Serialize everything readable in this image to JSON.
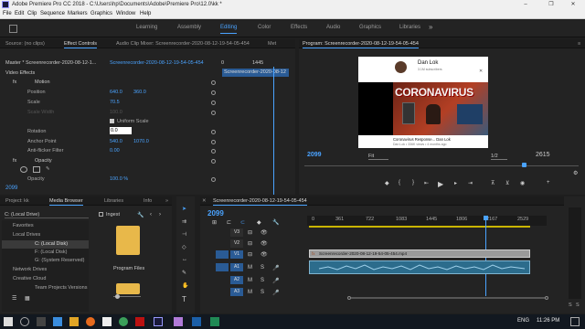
{
  "window": {
    "title": "Adobe Premiere Pro CC 2018 - C:\\Users\\hp\\Documents\\Adobe\\Premiere Pro\\12.0\\kk *",
    "minimize": "–",
    "maximize": "❐",
    "close": "✕"
  },
  "menu": [
    "File",
    "Edit",
    "Clip",
    "Sequence",
    "Markers",
    "Graphics",
    "Window",
    "Help"
  ],
  "workspaces": {
    "items": [
      "Learning",
      "Assembly",
      "Editing",
      "Color",
      "Effects",
      "Audio",
      "Graphics",
      "Libraries"
    ],
    "active": "Editing",
    "more": "»"
  },
  "effect_controls": {
    "tabs": [
      "Source: (no clips)",
      "Effect Controls",
      "Audio Clip Mixer: Screenrecorder-2020-08-12-19-54-05-454",
      "Met"
    ],
    "clip_path": "Master * Screenrecorder-2020-08-12-1...",
    "clip_name": "Screenrecorder-2020-08-12-19-54-05-454",
    "section_video": "Video Effects",
    "timecodes": [
      "0",
      "1445"
    ],
    "clip_label": "Screenrecorder-2020-08-12",
    "motion": "Motion",
    "position": {
      "label": "Position",
      "x": "640.0",
      "y": "360.0"
    },
    "scale": {
      "label": "Scale",
      "value": "70.5"
    },
    "scale_width": {
      "label": "Scale Width",
      "value": "100.0"
    },
    "uniform_scale": "Uniform Scale",
    "rotation": {
      "label": "Rotation",
      "value": "0.0"
    },
    "anchor": {
      "label": "Anchor Point",
      "x": "540.0",
      "y": "1070.0"
    },
    "anti_flicker": {
      "label": "Anti-flicker Filter",
      "value": "0.00"
    },
    "opacity": "Opacity",
    "opacity_value": {
      "label": "Opacity",
      "value": "100.0 %"
    },
    "timecode": "2099"
  },
  "program": {
    "title": "Program: Screenrecorder-2020-08-12-19-54-05-454",
    "menu": "≡",
    "video": {
      "channel": "Dan Lok",
      "subs": "3.1M subscribers",
      "headline": "CORONAVIRUS",
      "caption1": "Coronavirus Response... Dan Lok",
      "caption2": "Dan Lok • 336K views • 4 months ago"
    },
    "timecode": "2099",
    "fit": "Fit",
    "resolution": "1/2",
    "duration": "2615",
    "progress": 0.8
  },
  "project": {
    "tabs": [
      "Project: kk",
      "Media Browser",
      "Libraries",
      "Info"
    ],
    "more": "»",
    "drive_select": "C: (Local Drive)",
    "ingest": "Ingest",
    "tree": [
      {
        "label": "Favorites",
        "level": 0
      },
      {
        "label": "Local Drives",
        "level": 0
      },
      {
        "label": "C: (Local Disk)",
        "level": 1
      },
      {
        "label": "F: (Local Disk)",
        "level": 1
      },
      {
        "label": "G: (System Reserved)",
        "level": 1
      },
      {
        "label": "Network Drives",
        "level": 0
      },
      {
        "label": "Creative Cloud",
        "level": 0
      },
      {
        "label": "Team Projects Versions",
        "level": 1
      }
    ],
    "folder_label": "Program Files"
  },
  "timeline": {
    "title": "Screenrecorder-2020-08-12-19-54-05-454",
    "timecode": "2099",
    "ruler": [
      "0",
      "361",
      "722",
      "1083",
      "1445",
      "1806",
      "2167",
      "2529"
    ],
    "video_tracks": [
      "V3",
      "V2",
      "V1"
    ],
    "audio_tracks": [
      "A1",
      "A2",
      "A3"
    ],
    "clip_name": "Screenrecorder-2020-08-12-19-54-05-454.mp4",
    "fx": "fx",
    "meter_labels": [
      "S",
      "S"
    ]
  },
  "taskbar": {
    "lang": "ENG",
    "time": "11:26 PM"
  }
}
